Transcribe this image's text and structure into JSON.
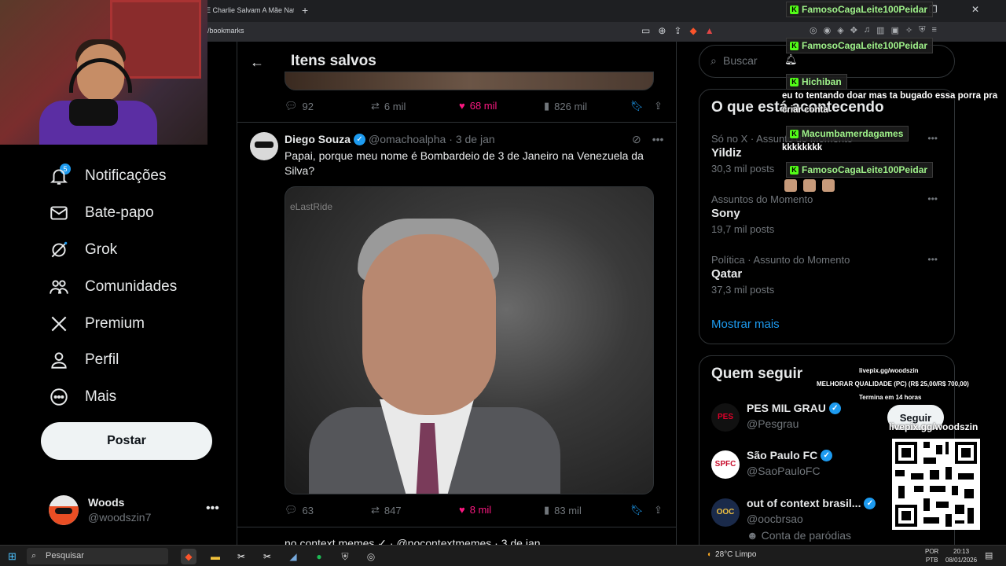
{
  "browser": {
    "tab_title": "E Charlie Salvam A Mãe Natu",
    "new_tab": "+",
    "window_controls": "— ❐ ✕",
    "url": "/bookmarks"
  },
  "nav": {
    "notifications_badge": "5",
    "items": [
      {
        "label": "Notificações",
        "icon": "bell-icon"
      },
      {
        "label": "Bate-papo",
        "icon": "envelope-icon"
      },
      {
        "label": "Grok",
        "icon": "grok-icon"
      },
      {
        "label": "Comunidades",
        "icon": "people-icon"
      },
      {
        "label": "Premium",
        "icon": "x-logo-icon"
      },
      {
        "label": "Perfil",
        "icon": "person-icon"
      },
      {
        "label": "Mais",
        "icon": "more-circle-icon"
      }
    ],
    "post_button": "Postar",
    "account": {
      "name": "Woods",
      "handle": "@woodszin7",
      "more": "•••"
    }
  },
  "center": {
    "title": "Itens salvos",
    "tweet1_actions": {
      "replies": "92",
      "retweets": "6 mil",
      "likes": "68 mil",
      "views": "826 mil"
    },
    "tweet2": {
      "name": "Diego Souza",
      "handle": "@omachoalpha",
      "date": "· 3 de jan",
      "text": "Papai, porque meu nome é Bombardeio de 3 de Janeiro na Venezuela da Silva?",
      "media_watermark": "eLastRide",
      "actions": {
        "replies": "63",
        "retweets": "847",
        "likes": "8 mil",
        "views": "83 mil"
      }
    },
    "next_peek": "no context memes ✓ · @nocontextmemes · 3 de jan"
  },
  "right": {
    "search_placeholder": "Buscar",
    "trends_title": "O que está acontecendo",
    "trends": [
      {
        "meta": "Só no X · Assunto do Momento",
        "title": "Yildiz",
        "count": "30,3 mil posts"
      },
      {
        "meta": "Assuntos do Momento",
        "title": "Sony",
        "count": "19,7 mil posts"
      },
      {
        "meta": "Política · Assunto do Momento",
        "title": "Qatar",
        "count": "37,3 mil posts"
      }
    ],
    "show_more": "Mostrar mais",
    "who_title": "Quem seguir",
    "follow_button": "Seguir",
    "who": [
      {
        "name": "PES MIL GRAU",
        "handle": "@Pesgrau",
        "logo": "PES",
        "logo_bg": "#111111",
        "logo_fg": "#e0002a"
      },
      {
        "name": "São Paulo FC",
        "handle": "@SaoPauloFC",
        "logo": "SPFC",
        "logo_bg": "#ffffff",
        "logo_fg": "#c8102e"
      },
      {
        "name": "out of context brasil...",
        "handle": "@oocbrsao",
        "logo": "OOC",
        "logo_bg": "#1a2a4a",
        "logo_fg": "#f0c040"
      }
    ],
    "parody_label": "Conta de paródias"
  },
  "chat": [
    {
      "user": "FamosoCagaLeite100Peidar",
      "message": ""
    },
    {
      "user": "FamosoCagaLeite100Peidar",
      "message": ""
    },
    {
      "user": "Hichiban",
      "message": "eu to tentando doar mas ta bugado essa porra pra criar conta"
    },
    {
      "user": "Macumbamerdagames",
      "message": "kkkkkkkk"
    },
    {
      "user": "FamosoCagaLeite100Peidar",
      "message": ""
    }
  ],
  "chat_msg_line1": "eu to tentando doar mas ta bugado essa porra pra",
  "chat_msg_line2": "criar conta",
  "livepix": {
    "small_url": "livepix.gg/woodszin",
    "quality": "MELHORAR QUALIDADE (PC) (R$ 25,00/R$ 700,00)",
    "ends": "Termina em 14 horas",
    "big_url": "livepix.gg/woodszin"
  },
  "taskbar": {
    "search": "Pesquisar",
    "weather": "28°C  Limpo",
    "lang1": "POR",
    "lang2": "PTB",
    "time": "20:13",
    "date": "08/01/2026"
  },
  "colors": {
    "accent": "#1d9bf0",
    "like": "#f91880",
    "background": "#000000"
  }
}
